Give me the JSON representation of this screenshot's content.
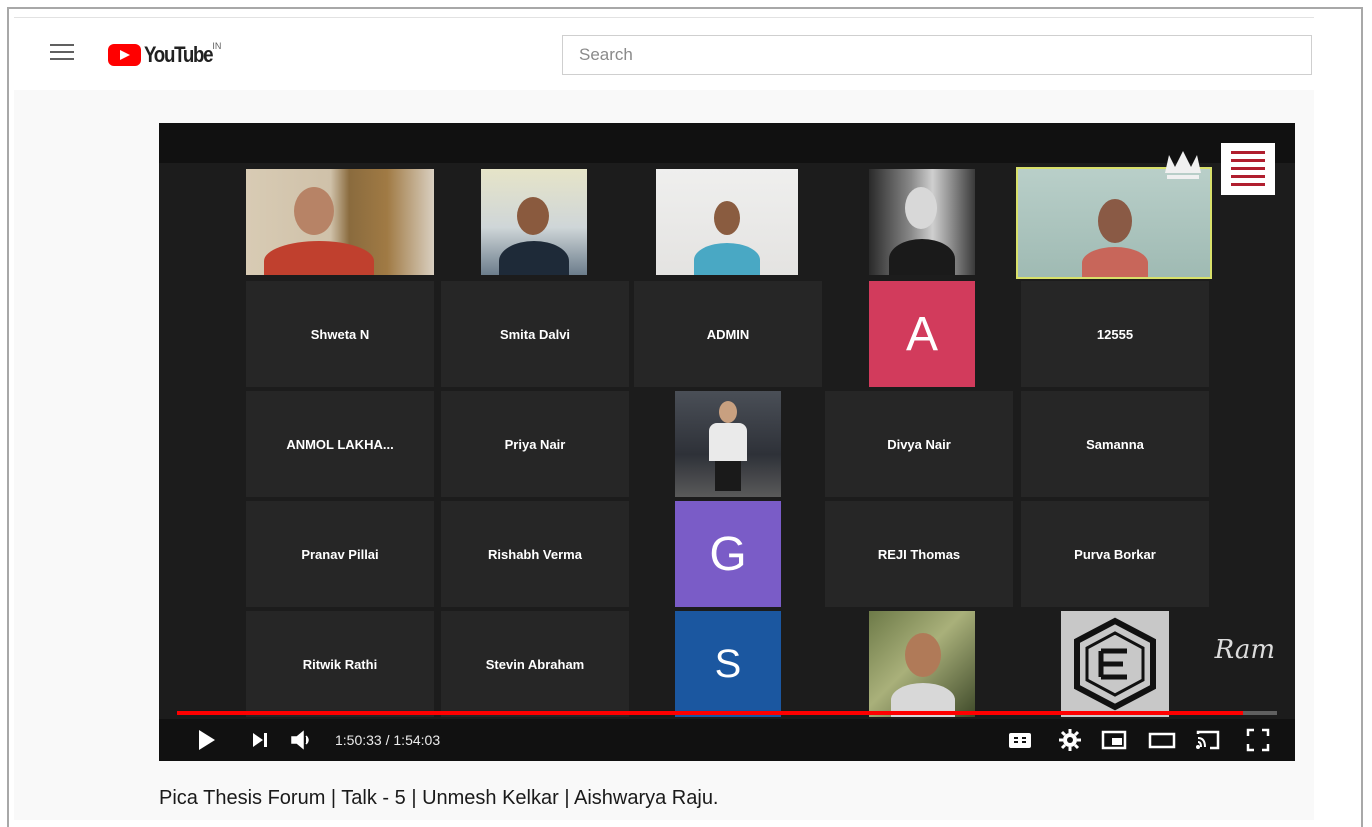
{
  "masthead": {
    "logo_text": "YouTube",
    "region": "IN",
    "search_placeholder": "Search"
  },
  "player": {
    "tiles": [
      {
        "label": "Shweta N"
      },
      {
        "label": "Smita Dalvi"
      },
      {
        "label": "ADMIN"
      },
      {
        "label": "A"
      },
      {
        "label": "12555"
      },
      {
        "label": "ANMOL LAKHA..."
      },
      {
        "label": "Priya Nair"
      },
      {
        "label": "Divya Nair"
      },
      {
        "label": "Samanna"
      },
      {
        "label": "Pranav Pillai"
      },
      {
        "label": "Rishabh Verma"
      },
      {
        "label": "G"
      },
      {
        "label": "REJI Thomas"
      },
      {
        "label": "Purva Borkar"
      },
      {
        "label": "Ritwik Rathi"
      },
      {
        "label": "Stevin Abraham"
      },
      {
        "label": "S"
      }
    ],
    "current_time": "1:50:33",
    "duration": "1:54:03",
    "progress": 0.969,
    "accent_color": "#ff0000"
  },
  "video": {
    "title": "Pica Thesis Forum | Talk - 5 | Unmesh Kelkar | Aishwarya Raju."
  }
}
